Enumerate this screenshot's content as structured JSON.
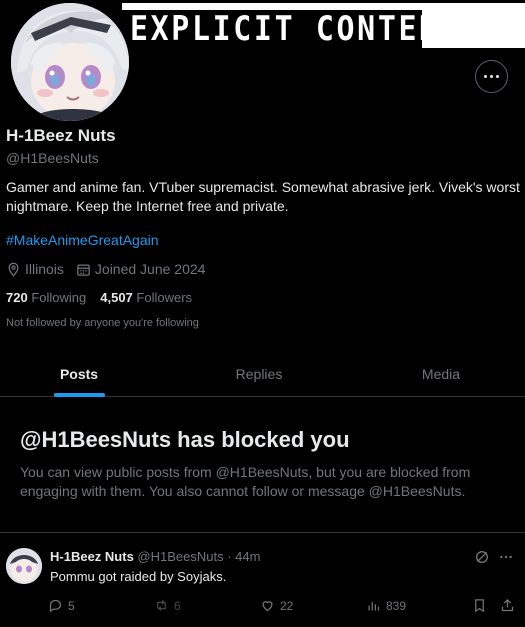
{
  "banner": {
    "text": "EXPLICIT CONTENT"
  },
  "profile": {
    "name": "H-1Beez Nuts",
    "handle": "@H1BeesNuts",
    "bio": "Gamer and anime fan. VTuber supremacist. Somewhat abrasive jerk. Vivek's worst nightmare. Keep the Internet free and private.",
    "hashtag": "#MakeAnimeGreatAgain",
    "location": "Illinois",
    "joined": "Joined June 2024",
    "following_count": "720",
    "following_label": "Following",
    "followers_count": "4,507",
    "followers_label": "Followers",
    "not_followed": "Not followed by anyone you're following"
  },
  "tabs": [
    {
      "label": "Posts",
      "active": true
    },
    {
      "label": "Replies",
      "active": false
    },
    {
      "label": "Media",
      "active": false
    }
  ],
  "blocked": {
    "title": "@H1BeesNuts has blocked you",
    "description": "You can view public posts from @H1BeesNuts, but you are blocked from engaging with them. You also cannot follow or message @H1BeesNuts."
  },
  "tweet": {
    "name": "H-1Beez Nuts",
    "handle_time": "@H1BeesNuts · 44m",
    "text": "Pommu got raided by Soyjaks.",
    "replies": "5",
    "reposts": "6",
    "likes": "22",
    "views": "839"
  },
  "colors": {
    "accent": "#1d9bf0",
    "muted": "#71767b",
    "text": "#e7e9ea",
    "background": "#000000",
    "border": "#2f3336"
  }
}
